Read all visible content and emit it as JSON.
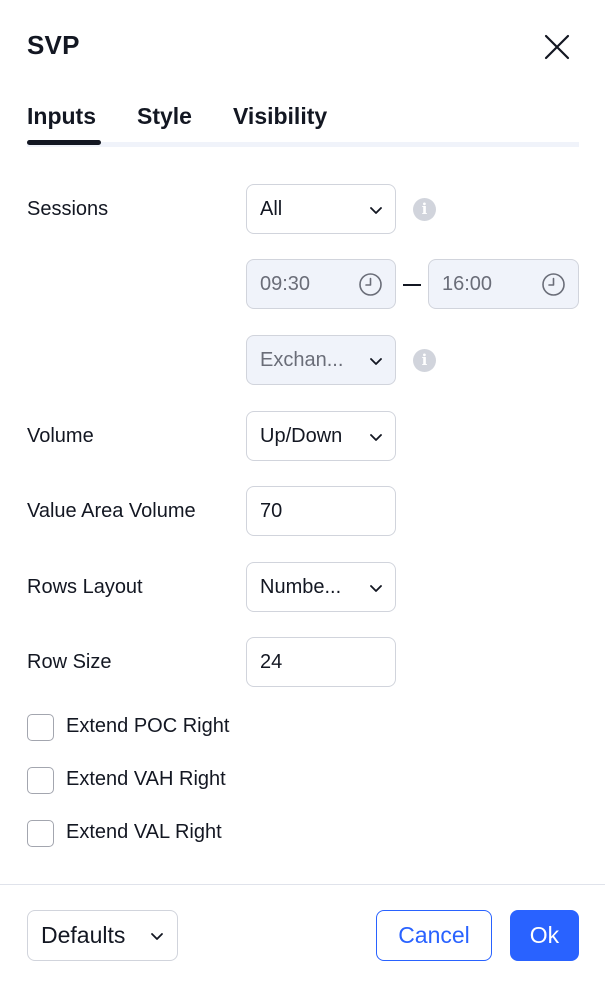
{
  "dialog": {
    "title": "SVP",
    "close_icon": "close-icon"
  },
  "tabs": [
    {
      "label": "Inputs",
      "active": true
    },
    {
      "label": "Style",
      "active": false
    },
    {
      "label": "Visibility",
      "active": false
    }
  ],
  "inputs": {
    "sessions": {
      "label": "Sessions",
      "value": "All",
      "info_icon": "info-icon"
    },
    "session_start": {
      "value": "09:30",
      "icon": "clock-icon"
    },
    "session_end": {
      "value": "16:00",
      "icon": "clock-icon"
    },
    "session_range_separator": "–",
    "timezone": {
      "value": "Exchan...",
      "info_icon": "info-icon"
    },
    "volume": {
      "label": "Volume",
      "value": "Up/Down"
    },
    "value_area_volume": {
      "label": "Value Area Volume",
      "value": "70"
    },
    "rows_layout": {
      "label": "Rows Layout",
      "value": "Numbe..."
    },
    "row_size": {
      "label": "Row Size",
      "value": "24"
    },
    "checkboxes": [
      {
        "label": "Extend POC Right",
        "checked": false
      },
      {
        "label": "Extend VAH Right",
        "checked": false
      },
      {
        "label": "Extend VAL Right",
        "checked": false
      }
    ]
  },
  "footer": {
    "defaults_label": "Defaults",
    "cancel_label": "Cancel",
    "ok_label": "Ok"
  },
  "colors": {
    "accent": "#2962ff",
    "text": "#131722",
    "border": "#d1d4dc",
    "disabled_bg": "#f0f3fa"
  }
}
